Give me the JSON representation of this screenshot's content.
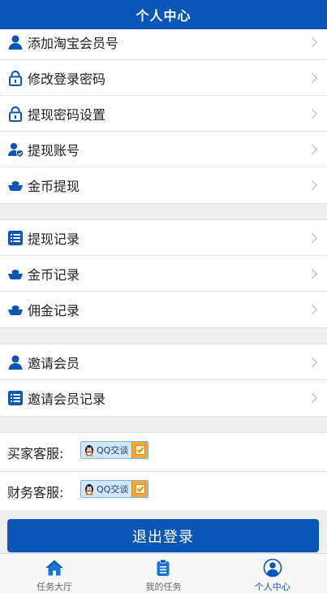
{
  "header": {
    "title": "个人中心"
  },
  "groups": [
    {
      "items": [
        {
          "label": "添加淘宝会员号",
          "icon": "user-icon"
        },
        {
          "label": "修改登录密码",
          "icon": "lock-icon"
        },
        {
          "label": "提现密码设置",
          "icon": "lock-icon"
        },
        {
          "label": "提现账号",
          "icon": "user-shield-icon"
        },
        {
          "label": "金币提现",
          "icon": "coin-icon"
        }
      ]
    },
    {
      "items": [
        {
          "label": "提现记录",
          "icon": "list-icon"
        },
        {
          "label": "金币记录",
          "icon": "coin-icon"
        },
        {
          "label": "佣金记录",
          "icon": "coin-icon"
        }
      ]
    },
    {
      "items": [
        {
          "label": "邀请会员",
          "icon": "user-icon"
        },
        {
          "label": "邀请会员记录",
          "icon": "list-icon"
        }
      ]
    }
  ],
  "service": [
    {
      "label": "买家客服:",
      "button": "QQ交谈"
    },
    {
      "label": "财务客服:",
      "button": "QQ交谈"
    }
  ],
  "logout": {
    "label": "退出登录"
  },
  "tabbar": [
    {
      "label": "任务大厅",
      "icon": "home-icon",
      "active": false
    },
    {
      "label": "我的任务",
      "icon": "clipboard-icon",
      "active": false
    },
    {
      "label": "个人中心",
      "icon": "person-circle-icon",
      "active": true
    }
  ],
  "colors": {
    "primary": "#0b55b8",
    "background": "#eeeeee"
  }
}
